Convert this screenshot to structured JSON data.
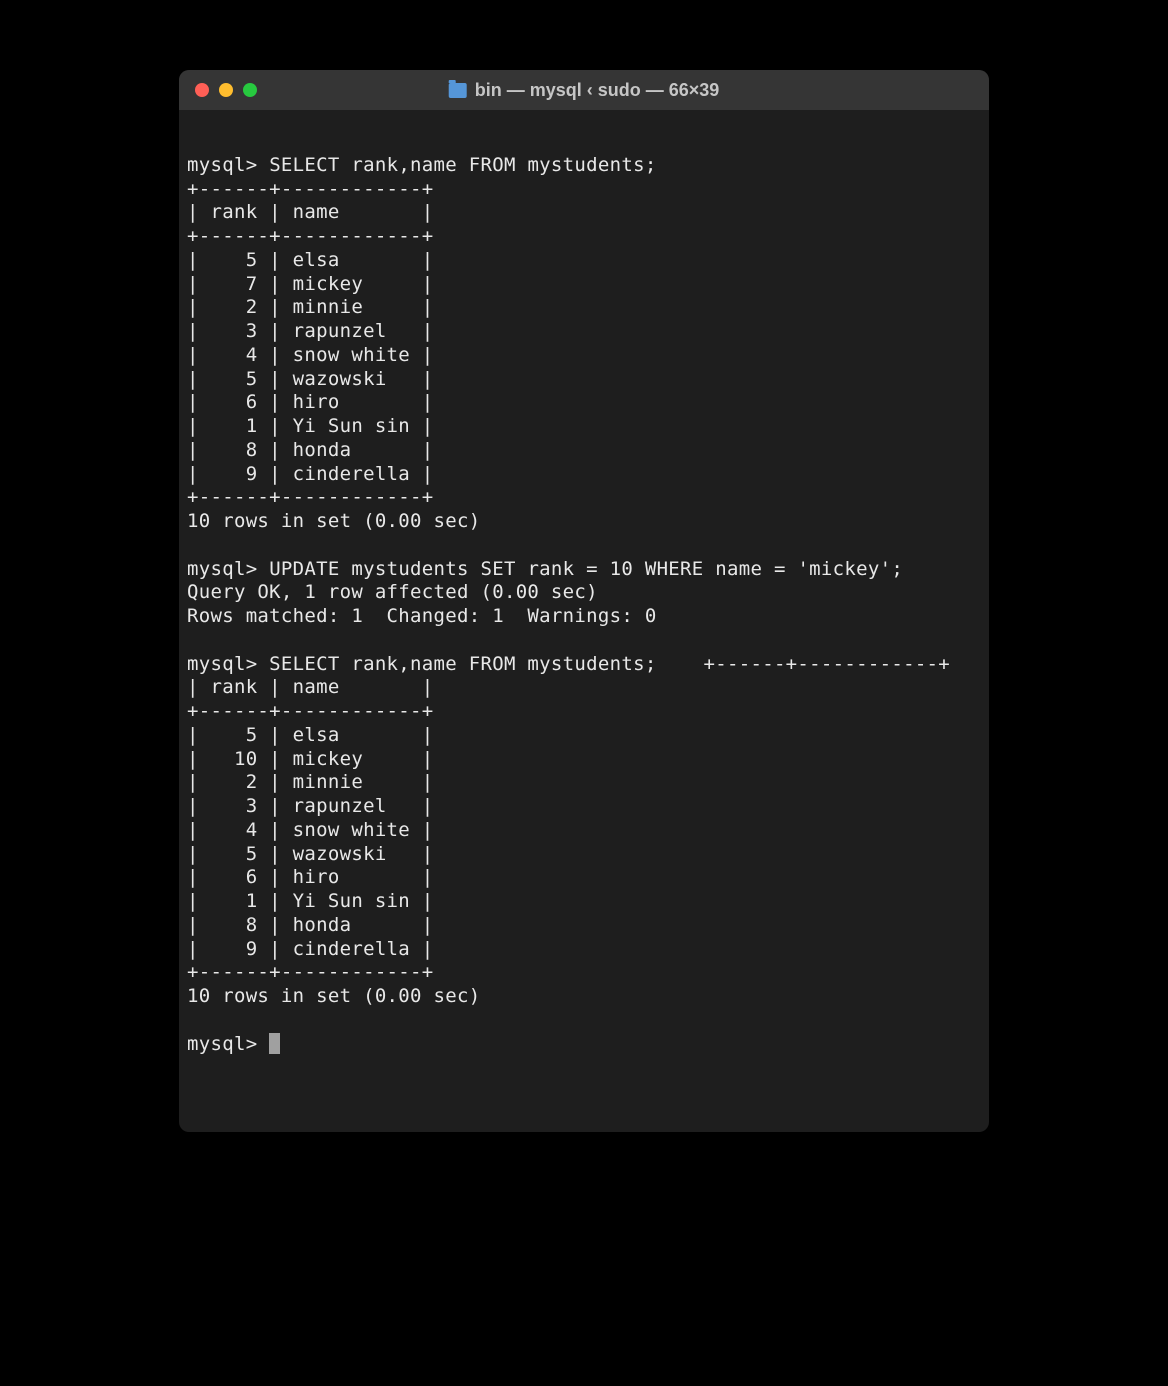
{
  "window": {
    "title": "bin — mysql ‹ sudo — 66×39"
  },
  "session": {
    "prompt": "mysql>",
    "query1": "SELECT rank,name FROM mystudents;",
    "table1_border_top": "+------+------------+",
    "table1_header": "| rank | name       |",
    "table1_border_mid": "+------+------------+",
    "table1_rows": [
      "|    5 | elsa       |",
      "|    7 | mickey     |",
      "|    2 | minnie     |",
      "|    3 | rapunzel   |",
      "|    4 | snow white |",
      "|    5 | wazowski   |",
      "|    6 | hiro       |",
      "|    1 | Yi Sun sin |",
      "|    8 | honda      |",
      "|    9 | cinderella |"
    ],
    "table1_border_bot": "+------+------------+",
    "result1": "10 rows in set (0.00 sec)",
    "query2": "UPDATE mystudents SET rank = 10 WHERE name = 'mickey';",
    "result2a": "Query OK, 1 row affected (0.00 sec)",
    "result2b": "Rows matched: 1  Changed: 1  Warnings: 0",
    "query3_line": "mysql> SELECT rank,name FROM mystudents;    +------+------------+",
    "table2_header": "| rank | name       |",
    "table2_border_mid": "+------+------------+",
    "table2_rows": [
      "|    5 | elsa       |",
      "|   10 | mickey     |",
      "|    2 | minnie     |",
      "|    3 | rapunzel   |",
      "|    4 | snow white |",
      "|    5 | wazowski   |",
      "|    6 | hiro       |",
      "|    1 | Yi Sun sin |",
      "|    8 | honda      |",
      "|    9 | cinderella |"
    ],
    "table2_border_bot": "+------+------------+",
    "result3": "10 rows in set (0.00 sec)"
  }
}
